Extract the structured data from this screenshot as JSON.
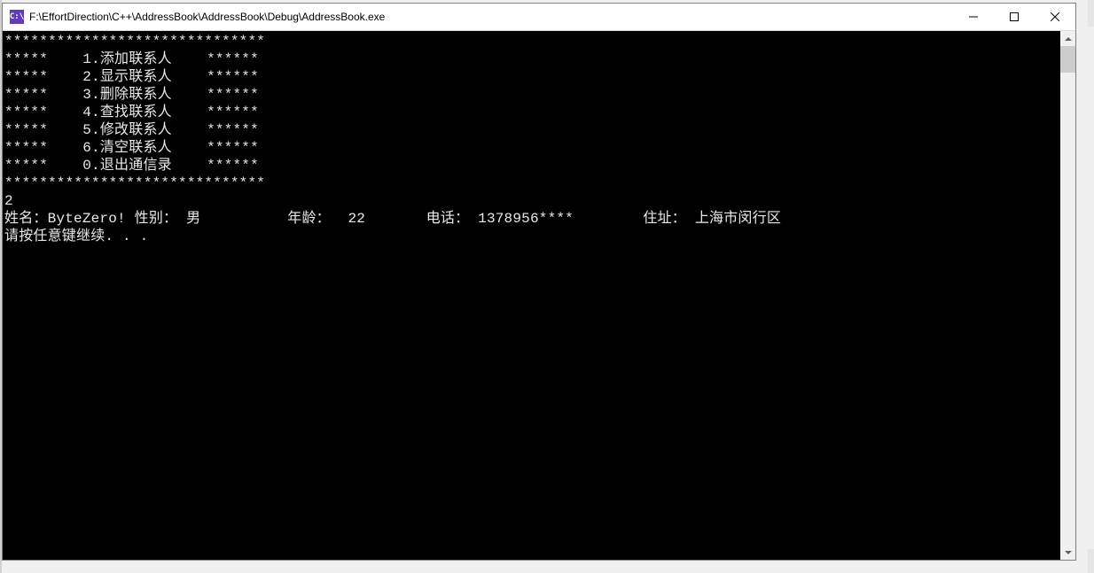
{
  "titlebar": {
    "icon_text": "C:\\",
    "title": "F:\\EffortDirection\\C++\\AddressBook\\AddressBook\\Debug\\AddressBook.exe"
  },
  "menu": {
    "border_top": "******************************",
    "rows": [
      {
        "left": "*****",
        "item": "1.添加联系人",
        "right": "******"
      },
      {
        "left": "*****",
        "item": "2.显示联系人",
        "right": "******"
      },
      {
        "left": "*****",
        "item": "3.删除联系人",
        "right": "******"
      },
      {
        "left": "*****",
        "item": "4.查找联系人",
        "right": "******"
      },
      {
        "left": "*****",
        "item": "5.修改联系人",
        "right": "******"
      },
      {
        "left": "*****",
        "item": "6.清空联系人",
        "right": "******"
      },
      {
        "left": "*****",
        "item": "0.退出通信录",
        "right": "******"
      }
    ],
    "border_bottom": "******************************"
  },
  "input_value": "2",
  "record": {
    "name_label": "姓名：",
    "name_value": "ByteZero!",
    "gender_label": "性别：",
    "gender_value": "男",
    "age_label": "年龄：",
    "age_value": "22",
    "phone_label": "电话：",
    "phone_value": "1378956****",
    "address_label": "住址：",
    "address_value": "上海市闵行区"
  },
  "prompt": "请按任意键继续. . ."
}
